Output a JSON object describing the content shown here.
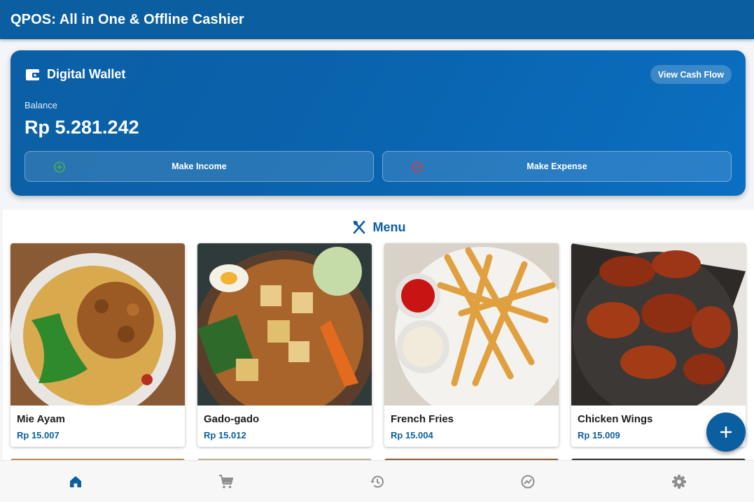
{
  "app": {
    "title": "QPOS: All in One & Offline Cashier"
  },
  "wallet": {
    "title": "Digital Wallet",
    "view_cash_flow_label": "View Cash Flow",
    "balance_label": "Balance",
    "balance_value": "Rp 5.281.242",
    "make_income_label": "Make Income",
    "make_expense_label": "Make Expense",
    "icon": "wallet-icon"
  },
  "menu": {
    "title": "Menu",
    "icon": "fork-knife-icon",
    "items": [
      {
        "name": "Mie Ayam",
        "price": "Rp 15.007"
      },
      {
        "name": "Gado-gado",
        "price": "Rp 15.012"
      },
      {
        "name": "French Fries",
        "price": "Rp 15.004"
      },
      {
        "name": "Chicken Wings",
        "price": "Rp 15.009"
      }
    ]
  },
  "fab": {
    "icon": "plus-icon"
  },
  "bottom_nav": [
    {
      "icon": "home-icon",
      "active": true
    },
    {
      "icon": "cart-icon",
      "active": false
    },
    {
      "icon": "history-icon",
      "active": false
    },
    {
      "icon": "analytics-icon",
      "active": false
    },
    {
      "icon": "settings-icon",
      "active": false
    }
  ],
  "colors": {
    "primary": "#0b5fa0",
    "income": "#4caf50",
    "expense": "#e53935",
    "nav_inactive": "#8e8e8e"
  }
}
